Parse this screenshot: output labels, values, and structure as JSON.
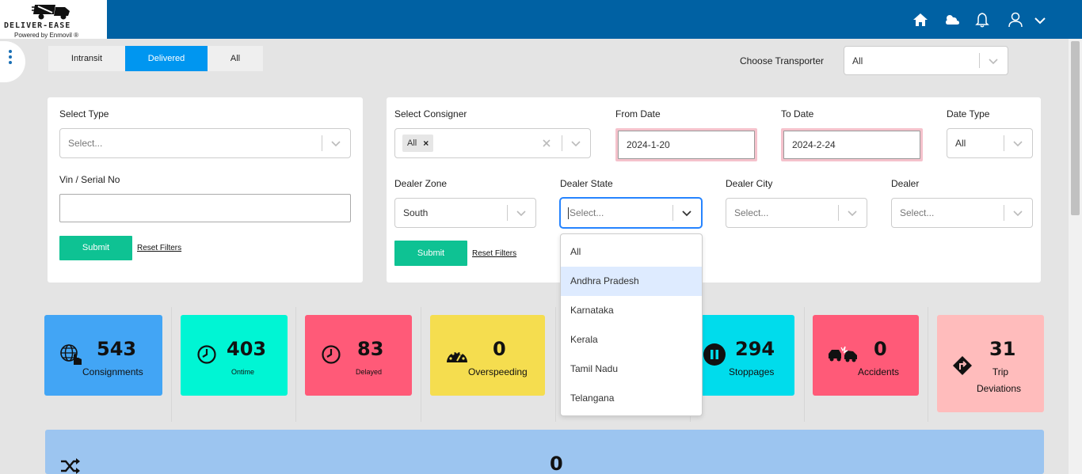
{
  "header": {
    "logo_text": "DELIVER-EASE",
    "logo_sub": "Powered by Enmovil ®",
    "brand_color": "#0061a3",
    "icons": [
      "home-icon",
      "weather-icon",
      "bell-icon",
      "user-icon",
      "chevron-down-icon"
    ]
  },
  "tabs": [
    {
      "label": "Intransit",
      "active": false
    },
    {
      "label": "Delivered",
      "active": true
    },
    {
      "label": "All",
      "active": false
    }
  ],
  "transporter": {
    "label": "Choose Transporter",
    "value": "All"
  },
  "left_filter": {
    "type_label": "Select Type",
    "type_placeholder": "Select...",
    "vin_label": "Vin / Serial No",
    "vin_value": "",
    "submit": "Submit",
    "reset": "Reset Filters"
  },
  "right_filter": {
    "consigner_label": "Select Consigner",
    "consigner_tag": "All",
    "from_label": "From Date",
    "from_value": "2024-1-20",
    "to_label": "To Date",
    "to_value": "2024-2-24",
    "datetype_label": "Date Type",
    "datetype_value": "All",
    "zone_label": "Dealer Zone",
    "zone_value": "South",
    "state_label": "Dealer State",
    "state_placeholder": "Select...",
    "city_label": "Dealer City",
    "city_placeholder": "Select...",
    "dealer_label": "Dealer",
    "dealer_placeholder": "Select...",
    "submit": "Submit",
    "reset": "Reset Filters"
  },
  "state_dropdown": {
    "options": [
      "All",
      "Andhra Pradesh",
      "Karnataka",
      "Kerala",
      "Tamil Nadu",
      "Telangana"
    ],
    "highlighted": "Andhra Pradesh"
  },
  "stats": [
    {
      "value": "543",
      "label": "Consignments",
      "color": "#42a5f5",
      "icon": "globe-hand-icon"
    },
    {
      "value": "403",
      "label": "Ontime",
      "color": "#00f5d4",
      "icon": "clock-icon"
    },
    {
      "value": "83",
      "label": "Delayed",
      "color": "#ff5a78",
      "icon": "clock-icon"
    },
    {
      "value": "0",
      "label": "Overspeeding",
      "color": "#f5dd4f",
      "icon": "speedometer-icon"
    },
    {
      "value": "294",
      "label": "Stoppages",
      "color": "#00dcec",
      "icon": "pause-icon"
    },
    {
      "value": "0",
      "label": "Accidents",
      "color": "#ff5a78",
      "icon": "accident-icon"
    },
    {
      "value": "31",
      "label": "Trip Deviations",
      "label_line1": "Trip",
      "label_line2": "Deviations",
      "color": "#ffbcbc",
      "icon": "turn-sign-icon"
    }
  ],
  "bottom": {
    "value": "0",
    "icon": "shuffle-icon",
    "color": "#9cc5f0"
  }
}
